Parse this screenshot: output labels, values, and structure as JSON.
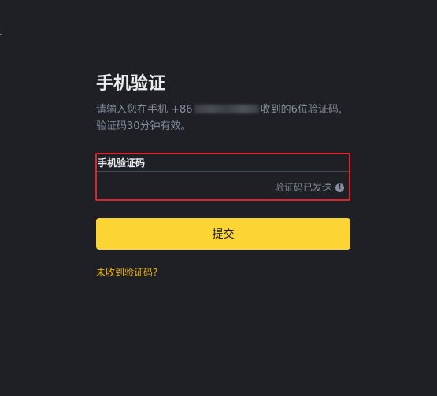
{
  "verification": {
    "title": "手机验证",
    "desc_line1_prefix": "请输入您在手机 +86",
    "desc_line1_suffix": "收到的6位验证码,",
    "desc_line2": "验证码30分钟有效。",
    "field_label": "手机验证码",
    "code_value": "",
    "sent_status": "验证码已发送",
    "info_icon": "info-icon",
    "submit_label": "提交",
    "resend_link": "未收到验证码?"
  },
  "colors": {
    "background": "#1f2026",
    "accent": "#fcd535",
    "link": "#f0b90b",
    "error_border": "#d8262c",
    "muted_text": "#848e9c"
  }
}
